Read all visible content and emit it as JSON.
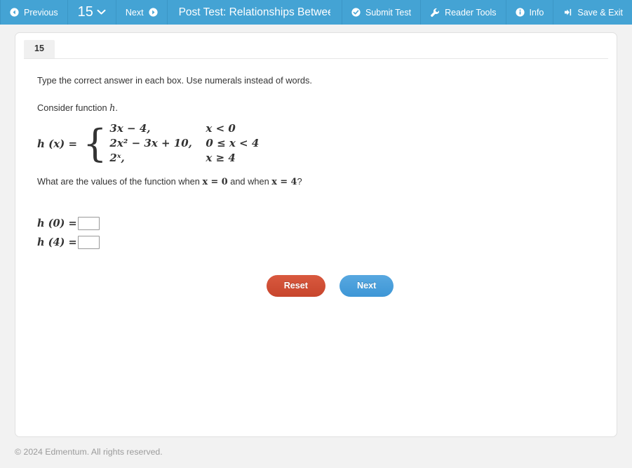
{
  "toolbar": {
    "previous_label": "Previous",
    "question_number": "15",
    "next_label": "Next",
    "test_title": "Post Test: Relationships Between F",
    "submit_label": "Submit Test",
    "reader_tools_label": "Reader Tools",
    "info_label": "Info",
    "save_exit_label": "Save & Exit",
    "background_color": "#44a3d4"
  },
  "card": {
    "tab_label": "15"
  },
  "question": {
    "instructions": "Type the correct answer in each box. Use numerals instead of words.",
    "consider_prefix": "Consider function ",
    "consider_function": "h",
    "consider_suffix": ".",
    "function_lhs": "h (x)  =",
    "pieces": [
      {
        "expression": "3x  −  4,",
        "condition": "x  <  0"
      },
      {
        "expression": "2x²  −  3x  +  10,",
        "condition": "0  ≤  x  <  4"
      },
      {
        "expression": "2ˣ,",
        "condition": "x  ≥  4"
      }
    ],
    "ask_part1": "What are the values of the function when ",
    "ask_math1": "x  =  0",
    "ask_part2": " and when ",
    "ask_math2": "x  =  4",
    "ask_part3": "?"
  },
  "answers": [
    {
      "label": "h (0)  =",
      "value": "",
      "name": "answer-input-h0"
    },
    {
      "label": "h (4)  =",
      "value": "",
      "name": "answer-input-h4"
    }
  ],
  "buttons": {
    "reset_label": "Reset",
    "reset_color": "#c7452c",
    "next_label": "Next",
    "next_color": "#3d96d6"
  },
  "footer": {
    "copyright": "© 2024 Edmentum. All rights reserved."
  }
}
